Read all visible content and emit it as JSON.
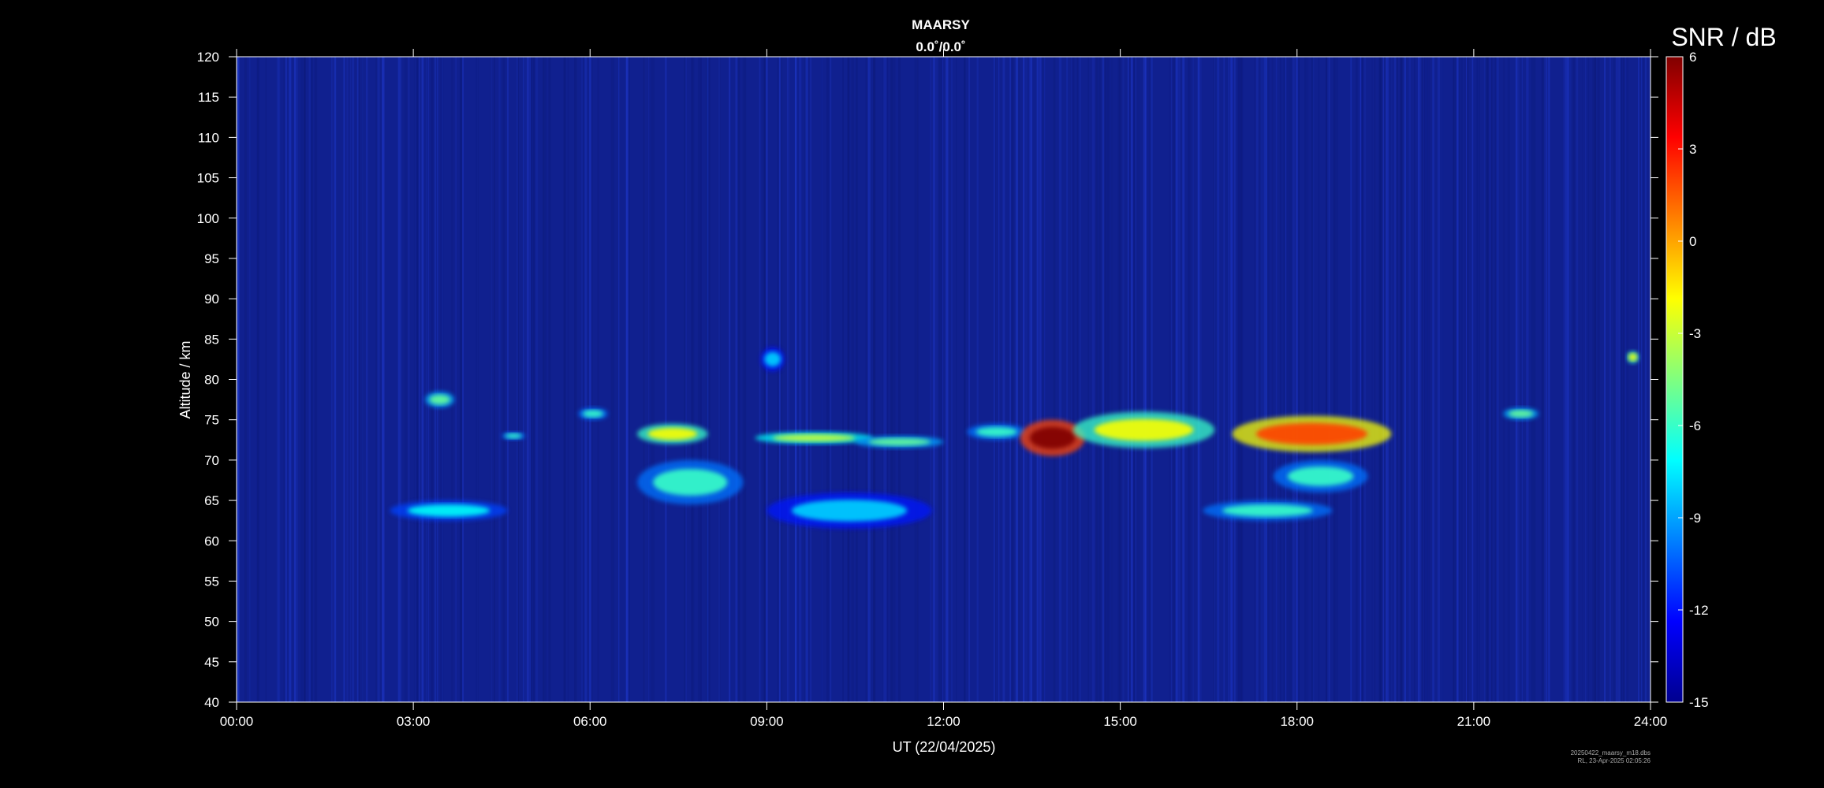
{
  "chart_data": {
    "type": "heatmap",
    "title": "MAARSY",
    "subtitle": "0.0˚/0.0˚",
    "xlabel": "UT (22/04/2025)",
    "ylabel": "Altitude / km",
    "xlim": [
      0,
      24
    ],
    "ylim": [
      40,
      120
    ],
    "x_ticks": [
      "00:00",
      "03:00",
      "06:00",
      "09:00",
      "12:00",
      "15:00",
      "18:00",
      "21:00",
      "24:00"
    ],
    "y_ticks": [
      "40",
      "45",
      "50",
      "55",
      "60",
      "65",
      "70",
      "75",
      "80",
      "85",
      "90",
      "95",
      "100",
      "105",
      "110",
      "115",
      "120"
    ],
    "colorbar": {
      "label": "SNR / dB",
      "range": [
        -15,
        6
      ],
      "ticks": [
        "6",
        "3",
        "0",
        "-3",
        "-6",
        "-9",
        "-12",
        "-15"
      ],
      "colormap": "jet"
    },
    "echo_regions": [
      {
        "t_start": 3.2,
        "t_end": 3.7,
        "alt_min": 76.5,
        "alt_max": 78.5,
        "snr": -5
      },
      {
        "t_start": 2.6,
        "t_end": 4.6,
        "alt_min": 62.5,
        "alt_max": 65,
        "snr": -7
      },
      {
        "t_start": 4.5,
        "t_end": 4.9,
        "alt_min": 72.5,
        "alt_max": 73.5,
        "snr": -6
      },
      {
        "t_start": 5.8,
        "t_end": 6.3,
        "alt_min": 75,
        "alt_max": 76.5,
        "snr": -6
      },
      {
        "t_start": 6.8,
        "t_end": 8.0,
        "alt_min": 72,
        "alt_max": 74.5,
        "snr": -2
      },
      {
        "t_start": 6.8,
        "t_end": 8.6,
        "alt_min": 64.5,
        "alt_max": 70,
        "snr": -6
      },
      {
        "t_start": 8.8,
        "t_end": 10.8,
        "alt_min": 72,
        "alt_max": 73.5,
        "snr": -3
      },
      {
        "t_start": 8.9,
        "t_end": 9.3,
        "alt_min": 81,
        "alt_max": 84,
        "snr": -8
      },
      {
        "t_start": 9.0,
        "t_end": 11.8,
        "alt_min": 61.5,
        "alt_max": 66,
        "snr": -8
      },
      {
        "t_start": 10.5,
        "t_end": 12.0,
        "alt_min": 71.5,
        "alt_max": 73,
        "snr": -5
      },
      {
        "t_start": 12.4,
        "t_end": 13.4,
        "alt_min": 72.5,
        "alt_max": 74.5,
        "snr": -6
      },
      {
        "t_start": 13.3,
        "t_end": 14.4,
        "alt_min": 70.5,
        "alt_max": 75,
        "snr": 6
      },
      {
        "t_start": 14.2,
        "t_end": 16.6,
        "alt_min": 71.5,
        "alt_max": 76,
        "snr": -2
      },
      {
        "t_start": 16.4,
        "t_end": 18.6,
        "alt_min": 62.5,
        "alt_max": 65,
        "snr": -6
      },
      {
        "t_start": 16.9,
        "t_end": 19.6,
        "alt_min": 71,
        "alt_max": 75.5,
        "snr": 2
      },
      {
        "t_start": 17.6,
        "t_end": 19.2,
        "alt_min": 66,
        "alt_max": 70,
        "snr": -6
      },
      {
        "t_start": 21.5,
        "t_end": 22.1,
        "alt_min": 75,
        "alt_max": 76.5,
        "snr": -5
      },
      {
        "t_start": 23.6,
        "t_end": 23.8,
        "alt_min": 82,
        "alt_max": 83.5,
        "snr": -2
      }
    ],
    "background_snr": -13,
    "grid": false
  },
  "footer": {
    "file": "20250422_maarsy_m18.dbs",
    "generated": "RL, 23-Apr-2025 02:05:26"
  },
  "colors": {
    "background": "#000000",
    "plot_bg": "#10208f",
    "axis": "#ffffff"
  }
}
